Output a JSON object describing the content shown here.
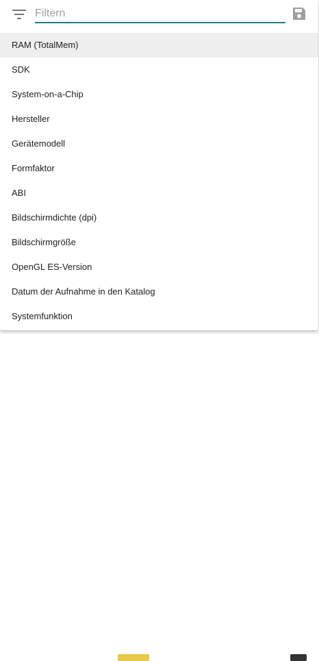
{
  "filter": {
    "placeholder": "Filtern",
    "value": ""
  },
  "menu_items": [
    {
      "label": "RAM (TotalMem)",
      "active": true
    },
    {
      "label": "SDK"
    },
    {
      "label": "System-on-a-Chip"
    },
    {
      "label": "Hersteller"
    },
    {
      "label": "Gerätemodell"
    },
    {
      "label": "Formfaktor"
    },
    {
      "label": "ABI"
    },
    {
      "label": "Bildschirmdichte (dpi)"
    },
    {
      "label": "Bildschirmgröße"
    },
    {
      "label": "OpenGL ES-Version"
    },
    {
      "label": "Datum der Aufnahme in den Katalog"
    },
    {
      "label": "Systemfunktion"
    }
  ],
  "colors": {
    "accent": "#1a7a8a",
    "icon": "#757575",
    "save_icon": "#9e9e9e",
    "active_row": "#eeeeee"
  },
  "icons": {
    "filter": "filter-list-icon",
    "save": "save-icon"
  }
}
